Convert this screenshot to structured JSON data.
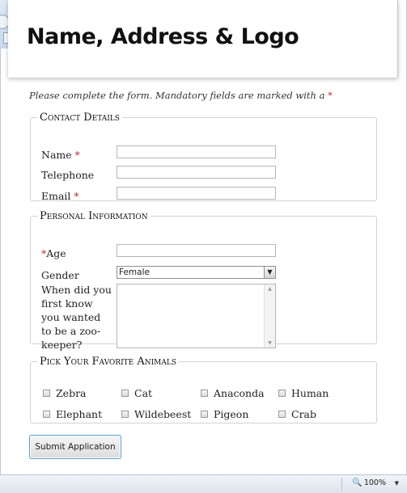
{
  "page": {
    "title": "Name, Address & Logo",
    "intro": "Please complete the form. Mandatory fields are marked with a",
    "required_marker": "*"
  },
  "contact": {
    "legend": "Contact Details",
    "fields": [
      {
        "label": "Name",
        "required": true,
        "value": ""
      },
      {
        "label": "Telephone",
        "required": false,
        "value": ""
      },
      {
        "label": "Email",
        "required": true,
        "value": ""
      }
    ]
  },
  "personal": {
    "legend": "Personal Information",
    "age": {
      "label": "Age",
      "required": true,
      "value": ""
    },
    "gender": {
      "label": "Gender",
      "selected": "Female"
    },
    "question": {
      "label": "When did you first know you wanted to be a zoo-keeper?",
      "value": ""
    }
  },
  "animals": {
    "legend": "Pick Your Favorite Animals",
    "options": [
      "Zebra",
      "Cat",
      "Anaconda",
      "Human",
      "Elephant",
      "Wildebeest",
      "Pigeon",
      "Crab"
    ]
  },
  "submit_label": "Submit Application",
  "statusbar": {
    "zoom": "100%"
  },
  "colors": {
    "required": "#c0282d",
    "button_border": "#4f9fd6"
  },
  "icons": {
    "zoom": "magnifier-icon",
    "zoom_dropdown": "triangle-down-icon"
  }
}
